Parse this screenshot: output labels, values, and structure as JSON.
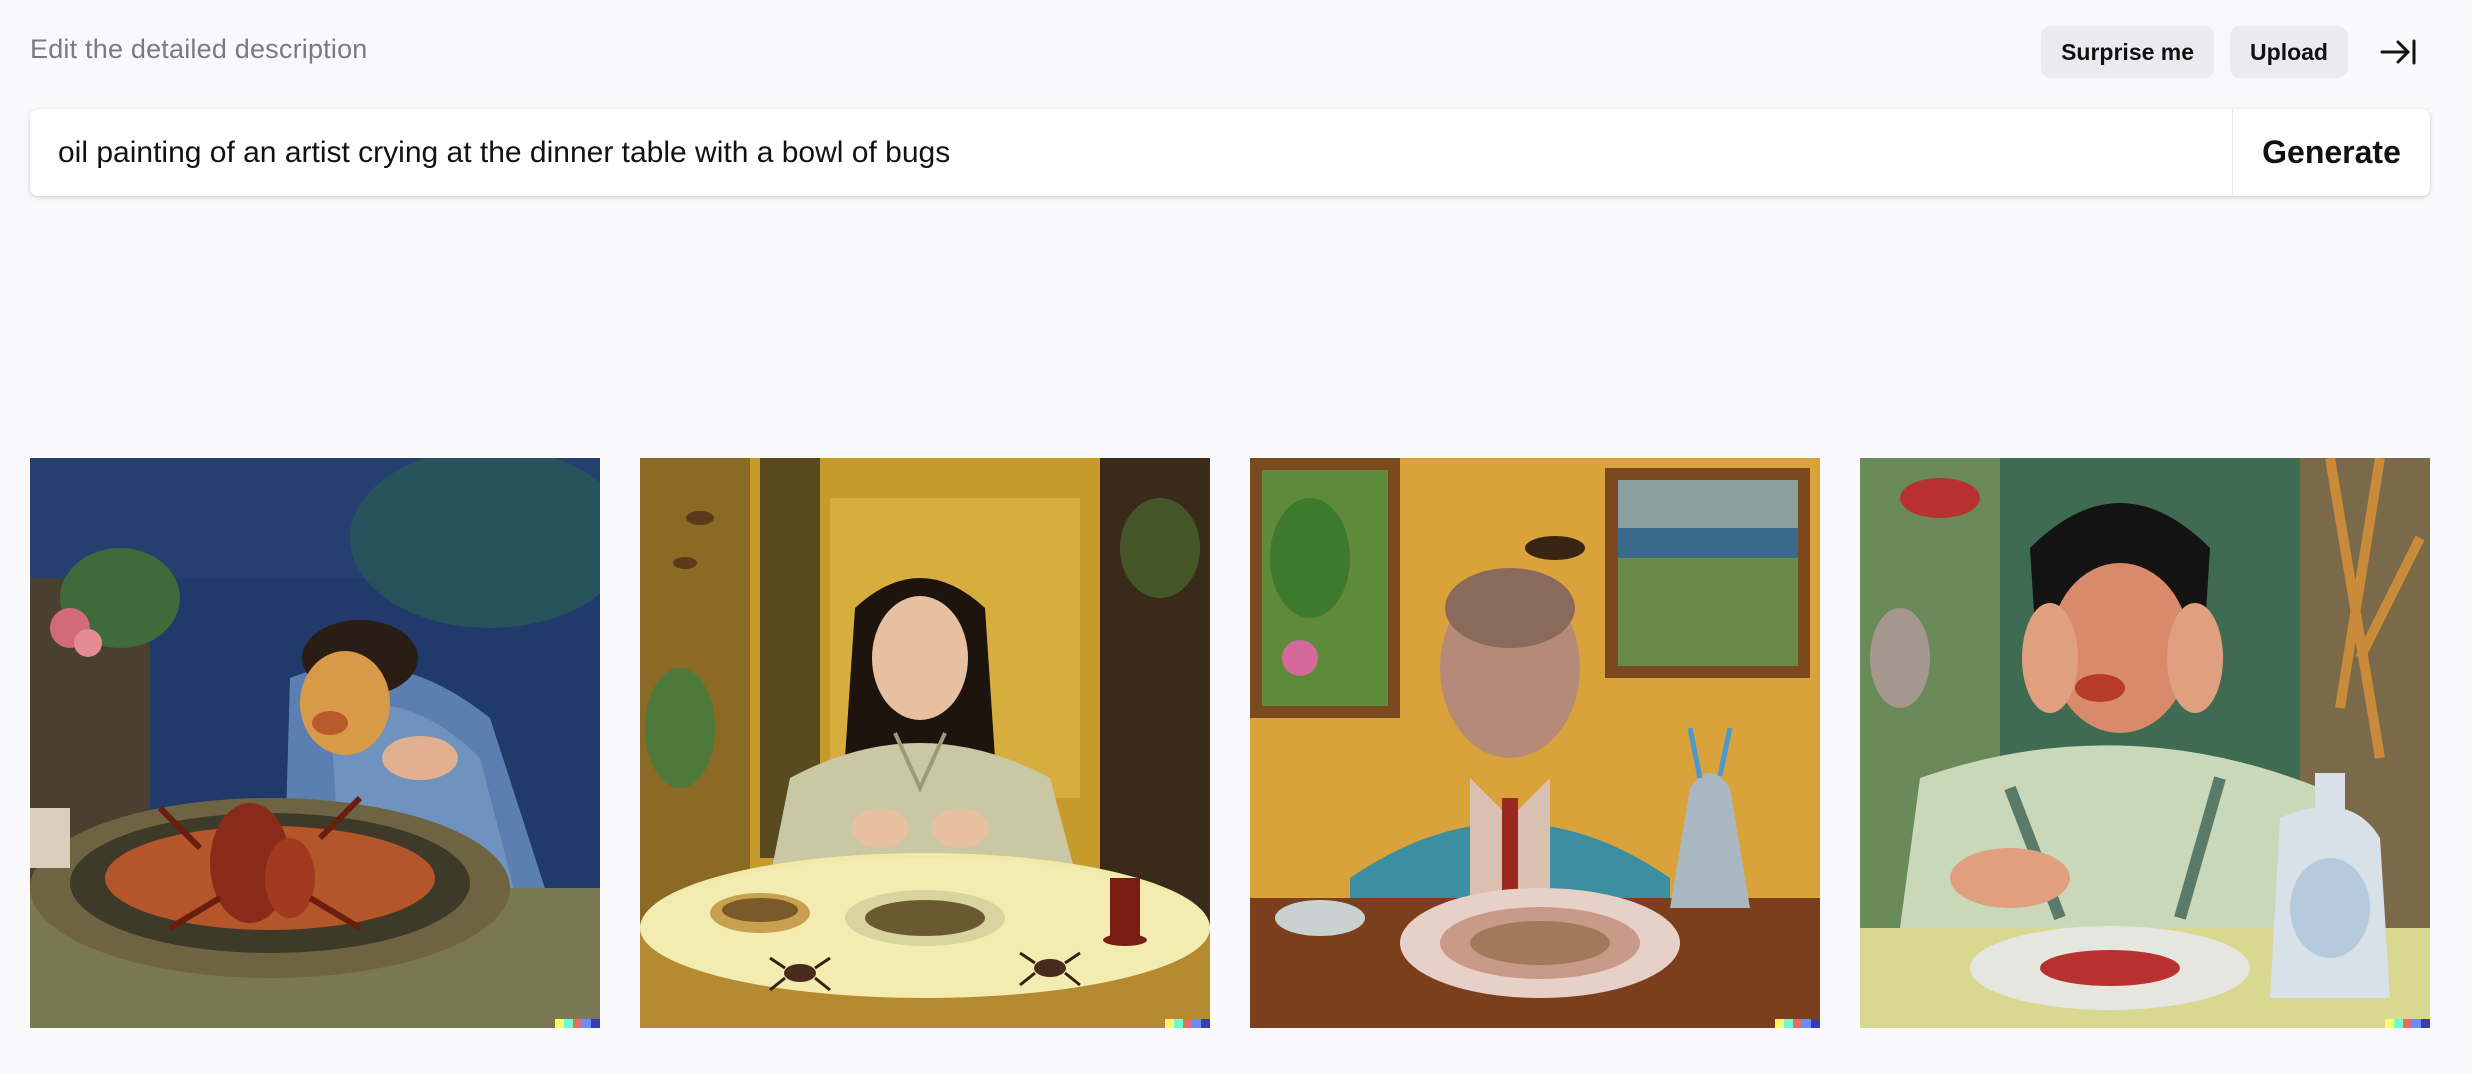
{
  "header": {
    "hint": "Edit the detailed description",
    "surprise_label": "Surprise me",
    "upload_label": "Upload",
    "collapse_icon": "collapse-right-icon"
  },
  "prompt": {
    "value": "oil painting of an artist crying at the dinner table with a bowl of bugs",
    "generate_label": "Generate"
  },
  "images": [
    {
      "subject": "man slumped over a bowl of crayfish",
      "palette": [
        "#1f3a6b",
        "#3b5f8a",
        "#9c7a48",
        "#c65a2c"
      ]
    },
    {
      "subject": "woman with dark hair at a round table with beetles",
      "palette": [
        "#c79a2c",
        "#5a4a20",
        "#e8e2a8",
        "#2b1d12"
      ]
    },
    {
      "subject": "bald man in teal suit with plate and vase",
      "palette": [
        "#d9a23b",
        "#7b3f1e",
        "#3b8fa0",
        "#c9a29a"
      ]
    },
    {
      "subject": "boy holding head in hands with plate and jug",
      "palette": [
        "#3e6b52",
        "#d98a6a",
        "#b7d4e0",
        "#7a4b2c"
      ]
    }
  ],
  "signature_colors": [
    "#fff86b",
    "#6bfccf",
    "#e86b6b",
    "#6b8cff",
    "#3b3bb8"
  ]
}
